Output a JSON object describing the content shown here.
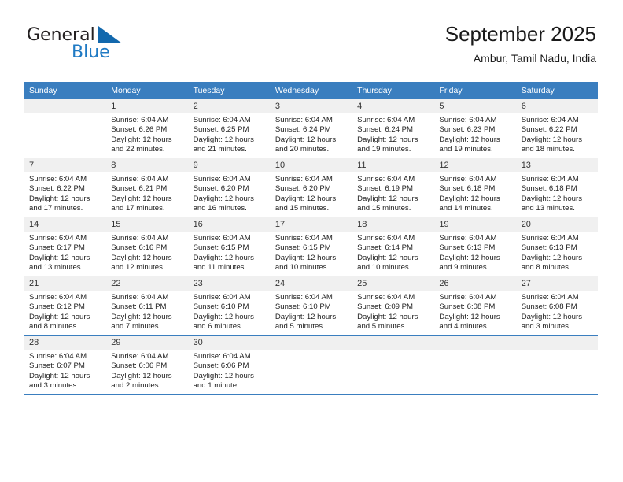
{
  "brand": {
    "name_part1": "General",
    "name_part2": "Blue",
    "triangle_color": "#1268ad",
    "blue_color": "#1f7ac4"
  },
  "header": {
    "title": "September 2025",
    "subtitle": "Ambur, Tamil Nadu, India"
  },
  "theme": {
    "header_row_bg": "#3a7ebf",
    "daynum_band_bg": "#f0f0f0",
    "grid_line": "#3a7ebf"
  },
  "weekday_headers": [
    "Sunday",
    "Monday",
    "Tuesday",
    "Wednesday",
    "Thursday",
    "Friday",
    "Saturday"
  ],
  "weeks": [
    [
      {
        "empty": true
      },
      {
        "day": "1",
        "sunrise": "Sunrise: 6:04 AM",
        "sunset": "Sunset: 6:26 PM",
        "daylight1": "Daylight: 12 hours",
        "daylight2": "and 22 minutes."
      },
      {
        "day": "2",
        "sunrise": "Sunrise: 6:04 AM",
        "sunset": "Sunset: 6:25 PM",
        "daylight1": "Daylight: 12 hours",
        "daylight2": "and 21 minutes."
      },
      {
        "day": "3",
        "sunrise": "Sunrise: 6:04 AM",
        "sunset": "Sunset: 6:24 PM",
        "daylight1": "Daylight: 12 hours",
        "daylight2": "and 20 minutes."
      },
      {
        "day": "4",
        "sunrise": "Sunrise: 6:04 AM",
        "sunset": "Sunset: 6:24 PM",
        "daylight1": "Daylight: 12 hours",
        "daylight2": "and 19 minutes."
      },
      {
        "day": "5",
        "sunrise": "Sunrise: 6:04 AM",
        "sunset": "Sunset: 6:23 PM",
        "daylight1": "Daylight: 12 hours",
        "daylight2": "and 19 minutes."
      },
      {
        "day": "6",
        "sunrise": "Sunrise: 6:04 AM",
        "sunset": "Sunset: 6:22 PM",
        "daylight1": "Daylight: 12 hours",
        "daylight2": "and 18 minutes."
      }
    ],
    [
      {
        "day": "7",
        "sunrise": "Sunrise: 6:04 AM",
        "sunset": "Sunset: 6:22 PM",
        "daylight1": "Daylight: 12 hours",
        "daylight2": "and 17 minutes."
      },
      {
        "day": "8",
        "sunrise": "Sunrise: 6:04 AM",
        "sunset": "Sunset: 6:21 PM",
        "daylight1": "Daylight: 12 hours",
        "daylight2": "and 17 minutes."
      },
      {
        "day": "9",
        "sunrise": "Sunrise: 6:04 AM",
        "sunset": "Sunset: 6:20 PM",
        "daylight1": "Daylight: 12 hours",
        "daylight2": "and 16 minutes."
      },
      {
        "day": "10",
        "sunrise": "Sunrise: 6:04 AM",
        "sunset": "Sunset: 6:20 PM",
        "daylight1": "Daylight: 12 hours",
        "daylight2": "and 15 minutes."
      },
      {
        "day": "11",
        "sunrise": "Sunrise: 6:04 AM",
        "sunset": "Sunset: 6:19 PM",
        "daylight1": "Daylight: 12 hours",
        "daylight2": "and 15 minutes."
      },
      {
        "day": "12",
        "sunrise": "Sunrise: 6:04 AM",
        "sunset": "Sunset: 6:18 PM",
        "daylight1": "Daylight: 12 hours",
        "daylight2": "and 14 minutes."
      },
      {
        "day": "13",
        "sunrise": "Sunrise: 6:04 AM",
        "sunset": "Sunset: 6:18 PM",
        "daylight1": "Daylight: 12 hours",
        "daylight2": "and 13 minutes."
      }
    ],
    [
      {
        "day": "14",
        "sunrise": "Sunrise: 6:04 AM",
        "sunset": "Sunset: 6:17 PM",
        "daylight1": "Daylight: 12 hours",
        "daylight2": "and 13 minutes."
      },
      {
        "day": "15",
        "sunrise": "Sunrise: 6:04 AM",
        "sunset": "Sunset: 6:16 PM",
        "daylight1": "Daylight: 12 hours",
        "daylight2": "and 12 minutes."
      },
      {
        "day": "16",
        "sunrise": "Sunrise: 6:04 AM",
        "sunset": "Sunset: 6:15 PM",
        "daylight1": "Daylight: 12 hours",
        "daylight2": "and 11 minutes."
      },
      {
        "day": "17",
        "sunrise": "Sunrise: 6:04 AM",
        "sunset": "Sunset: 6:15 PM",
        "daylight1": "Daylight: 12 hours",
        "daylight2": "and 10 minutes."
      },
      {
        "day": "18",
        "sunrise": "Sunrise: 6:04 AM",
        "sunset": "Sunset: 6:14 PM",
        "daylight1": "Daylight: 12 hours",
        "daylight2": "and 10 minutes."
      },
      {
        "day": "19",
        "sunrise": "Sunrise: 6:04 AM",
        "sunset": "Sunset: 6:13 PM",
        "daylight1": "Daylight: 12 hours",
        "daylight2": "and 9 minutes."
      },
      {
        "day": "20",
        "sunrise": "Sunrise: 6:04 AM",
        "sunset": "Sunset: 6:13 PM",
        "daylight1": "Daylight: 12 hours",
        "daylight2": "and 8 minutes."
      }
    ],
    [
      {
        "day": "21",
        "sunrise": "Sunrise: 6:04 AM",
        "sunset": "Sunset: 6:12 PM",
        "daylight1": "Daylight: 12 hours",
        "daylight2": "and 8 minutes."
      },
      {
        "day": "22",
        "sunrise": "Sunrise: 6:04 AM",
        "sunset": "Sunset: 6:11 PM",
        "daylight1": "Daylight: 12 hours",
        "daylight2": "and 7 minutes."
      },
      {
        "day": "23",
        "sunrise": "Sunrise: 6:04 AM",
        "sunset": "Sunset: 6:10 PM",
        "daylight1": "Daylight: 12 hours",
        "daylight2": "and 6 minutes."
      },
      {
        "day": "24",
        "sunrise": "Sunrise: 6:04 AM",
        "sunset": "Sunset: 6:10 PM",
        "daylight1": "Daylight: 12 hours",
        "daylight2": "and 5 minutes."
      },
      {
        "day": "25",
        "sunrise": "Sunrise: 6:04 AM",
        "sunset": "Sunset: 6:09 PM",
        "daylight1": "Daylight: 12 hours",
        "daylight2": "and 5 minutes."
      },
      {
        "day": "26",
        "sunrise": "Sunrise: 6:04 AM",
        "sunset": "Sunset: 6:08 PM",
        "daylight1": "Daylight: 12 hours",
        "daylight2": "and 4 minutes."
      },
      {
        "day": "27",
        "sunrise": "Sunrise: 6:04 AM",
        "sunset": "Sunset: 6:08 PM",
        "daylight1": "Daylight: 12 hours",
        "daylight2": "and 3 minutes."
      }
    ],
    [
      {
        "day": "28",
        "sunrise": "Sunrise: 6:04 AM",
        "sunset": "Sunset: 6:07 PM",
        "daylight1": "Daylight: 12 hours",
        "daylight2": "and 3 minutes."
      },
      {
        "day": "29",
        "sunrise": "Sunrise: 6:04 AM",
        "sunset": "Sunset: 6:06 PM",
        "daylight1": "Daylight: 12 hours",
        "daylight2": "and 2 minutes."
      },
      {
        "day": "30",
        "sunrise": "Sunrise: 6:04 AM",
        "sunset": "Sunset: 6:06 PM",
        "daylight1": "Daylight: 12 hours",
        "daylight2": "and 1 minute."
      },
      {
        "empty": true
      },
      {
        "empty": true
      },
      {
        "empty": true
      },
      {
        "empty": true
      }
    ]
  ]
}
